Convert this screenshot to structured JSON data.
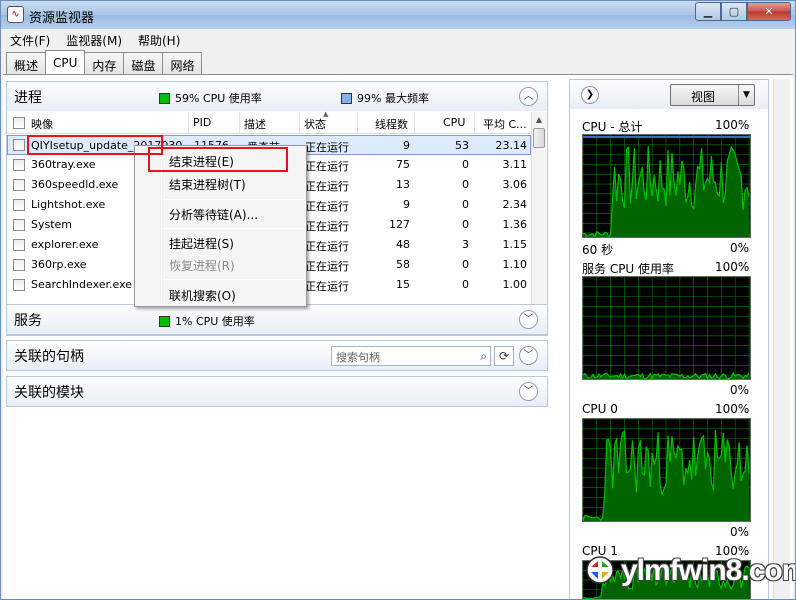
{
  "window": {
    "title": "资源监视器",
    "app_icon_glyph": "∿"
  },
  "menu": [
    "文件(F)",
    "监视器(M)",
    "帮助(H)"
  ],
  "tabs": [
    "概述",
    "CPU",
    "内存",
    "磁盘",
    "网络"
  ],
  "active_tab": "CPU",
  "processes": {
    "title": "进程",
    "stat_cpu": "59% CPU 使用率",
    "stat_freq": "99% 最大频率",
    "columns": [
      "映像",
      "PID",
      "描述",
      "状态",
      "线程数",
      "CPU",
      "平均 C..."
    ],
    "rows": [
      {
        "image": "QIYIsetup_update_2017030",
        "pid": "11576",
        "desc": "爱奇艺",
        "status": "正在运行",
        "threads": "9",
        "cpu": "53",
        "avg": "23.14"
      },
      {
        "image": "360tray.exe",
        "pid": "",
        "desc": "",
        "status": "正在运行",
        "threads": "75",
        "cpu": "0",
        "avg": "3.11"
      },
      {
        "image": "360speedld.exe",
        "pid": "",
        "desc": "",
        "status": "正在运行",
        "threads": "13",
        "cpu": "0",
        "avg": "3.06"
      },
      {
        "image": "Lightshot.exe",
        "pid": "",
        "desc": "",
        "status": "正在运行",
        "threads": "9",
        "cpu": "0",
        "avg": "2.34"
      },
      {
        "image": "System",
        "pid": "",
        "desc": "",
        "status": "正在运行",
        "threads": "127",
        "cpu": "0",
        "avg": "1.36"
      },
      {
        "image": "explorer.exe",
        "pid": "",
        "desc": "",
        "status": "正在运行",
        "threads": "48",
        "cpu": "3",
        "avg": "1.15"
      },
      {
        "image": "360rp.exe",
        "pid": "",
        "desc": "",
        "status": "正在运行",
        "threads": "58",
        "cpu": "0",
        "avg": "1.10"
      },
      {
        "image": "SearchIndexer.exe",
        "pid": "",
        "desc": "",
        "status": "正在运行",
        "threads": "15",
        "cpu": "0",
        "avg": "1.00"
      }
    ]
  },
  "context_menu": {
    "items": [
      "结束进程(E)",
      "结束进程树(T)",
      "分析等待链(A)...",
      "挂起进程(S)",
      "恢复进程(R)",
      "联机搜索(O)"
    ],
    "disabled": [
      "恢复进程(R)"
    ]
  },
  "services": {
    "title": "服务",
    "stat_cpu": "1% CPU 使用率"
  },
  "handles": {
    "title": "关联的句柄",
    "search_placeholder": "搜索句柄"
  },
  "modules": {
    "title": "关联的模块"
  },
  "right_panel": {
    "view_button": "视图",
    "graphs": [
      {
        "title": "CPU - 总计",
        "max": "100%",
        "bottom_left": "60 秒",
        "bottom_right": "0%"
      },
      {
        "title": "服务 CPU 使用率",
        "max": "100%",
        "bottom_left": "",
        "bottom_right": "0%"
      },
      {
        "title": "CPU 0",
        "max": "100%",
        "bottom_left": "",
        "bottom_right": "0%"
      },
      {
        "title": "CPU 1",
        "max": "100%",
        "bottom_left": "",
        "bottom_right": ""
      }
    ]
  },
  "watermark": "ylmfwin8.com",
  "colors": {
    "graph_green": "#00c000",
    "graph_fill": "#006400",
    "graph_grid": "#008000",
    "graph_freq": "#3c6cc8",
    "highlight": "#e8141b"
  }
}
